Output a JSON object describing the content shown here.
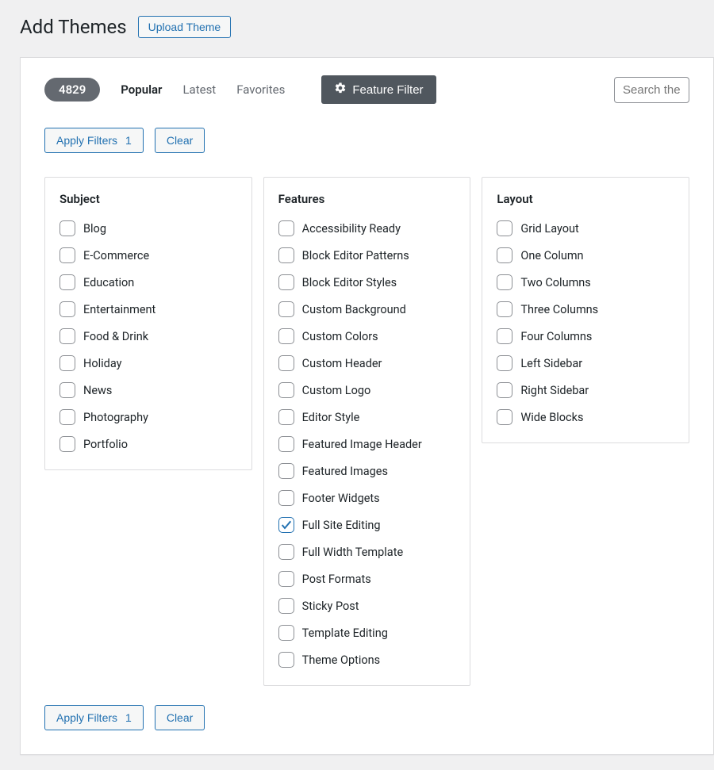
{
  "header": {
    "title": "Add Themes",
    "upload_label": "Upload Theme"
  },
  "filter_bar": {
    "count": "4829",
    "links": {
      "popular": "Popular",
      "latest": "Latest",
      "favorites": "Favorites"
    },
    "feature_filter_label": "Feature Filter",
    "search_placeholder": "Search themes..."
  },
  "actions": {
    "apply_label": "Apply Filters",
    "apply_count": "1",
    "clear_label": "Clear"
  },
  "groups": {
    "subject": {
      "title": "Subject",
      "items": [
        {
          "label": "Blog",
          "checked": false
        },
        {
          "label": "E-Commerce",
          "checked": false
        },
        {
          "label": "Education",
          "checked": false
        },
        {
          "label": "Entertainment",
          "checked": false
        },
        {
          "label": "Food & Drink",
          "checked": false
        },
        {
          "label": "Holiday",
          "checked": false
        },
        {
          "label": "News",
          "checked": false
        },
        {
          "label": "Photography",
          "checked": false
        },
        {
          "label": "Portfolio",
          "checked": false
        }
      ]
    },
    "features": {
      "title": "Features",
      "items": [
        {
          "label": "Accessibility Ready",
          "checked": false
        },
        {
          "label": "Block Editor Patterns",
          "checked": false
        },
        {
          "label": "Block Editor Styles",
          "checked": false
        },
        {
          "label": "Custom Background",
          "checked": false
        },
        {
          "label": "Custom Colors",
          "checked": false
        },
        {
          "label": "Custom Header",
          "checked": false
        },
        {
          "label": "Custom Logo",
          "checked": false
        },
        {
          "label": "Editor Style",
          "checked": false
        },
        {
          "label": "Featured Image Header",
          "checked": false
        },
        {
          "label": "Featured Images",
          "checked": false
        },
        {
          "label": "Footer Widgets",
          "checked": false
        },
        {
          "label": "Full Site Editing",
          "checked": true
        },
        {
          "label": "Full Width Template",
          "checked": false
        },
        {
          "label": "Post Formats",
          "checked": false
        },
        {
          "label": "Sticky Post",
          "checked": false
        },
        {
          "label": "Template Editing",
          "checked": false
        },
        {
          "label": "Theme Options",
          "checked": false
        }
      ]
    },
    "layout": {
      "title": "Layout",
      "items": [
        {
          "label": "Grid Layout",
          "checked": false
        },
        {
          "label": "One Column",
          "checked": false
        },
        {
          "label": "Two Columns",
          "checked": false
        },
        {
          "label": "Three Columns",
          "checked": false
        },
        {
          "label": "Four Columns",
          "checked": false
        },
        {
          "label": "Left Sidebar",
          "checked": false
        },
        {
          "label": "Right Sidebar",
          "checked": false
        },
        {
          "label": "Wide Blocks",
          "checked": false
        }
      ]
    }
  }
}
